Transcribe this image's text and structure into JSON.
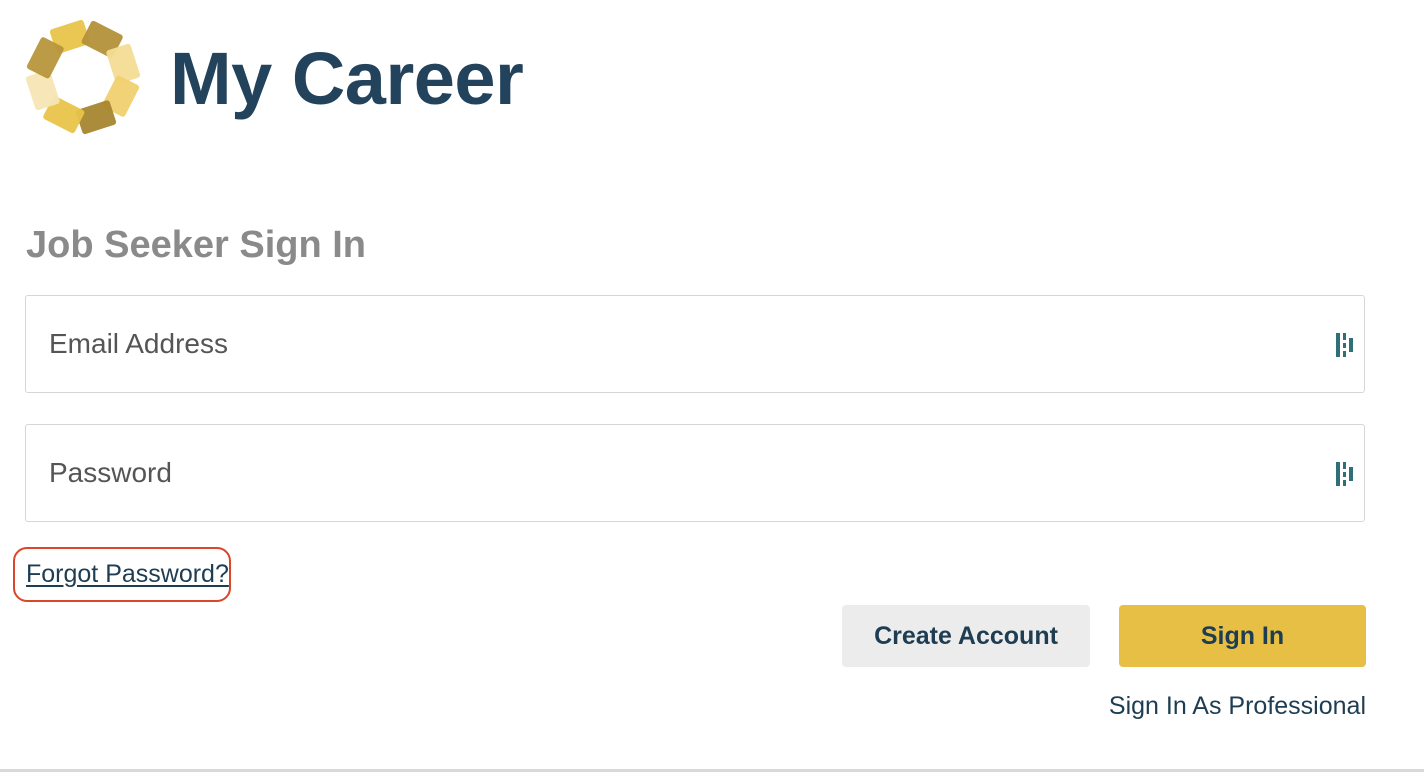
{
  "header": {
    "logo": "sunburst-logo",
    "title": "My Career"
  },
  "form": {
    "heading": "Job Seeker Sign In",
    "email_placeholder": "Email Address",
    "email_value": "",
    "password_placeholder": "Password",
    "password_value": "",
    "field_icon": "password-manager-icon",
    "forgot_label": "Forgot Password?",
    "create_label": "Create Account",
    "signin_label": "Sign In",
    "professional_label": "Sign In As Professional"
  },
  "colors": {
    "brand_navy": "#22435b",
    "accent_gold": "#e8bf45",
    "highlight_red": "#d9472b",
    "heading_gray": "#8a8a8a"
  }
}
